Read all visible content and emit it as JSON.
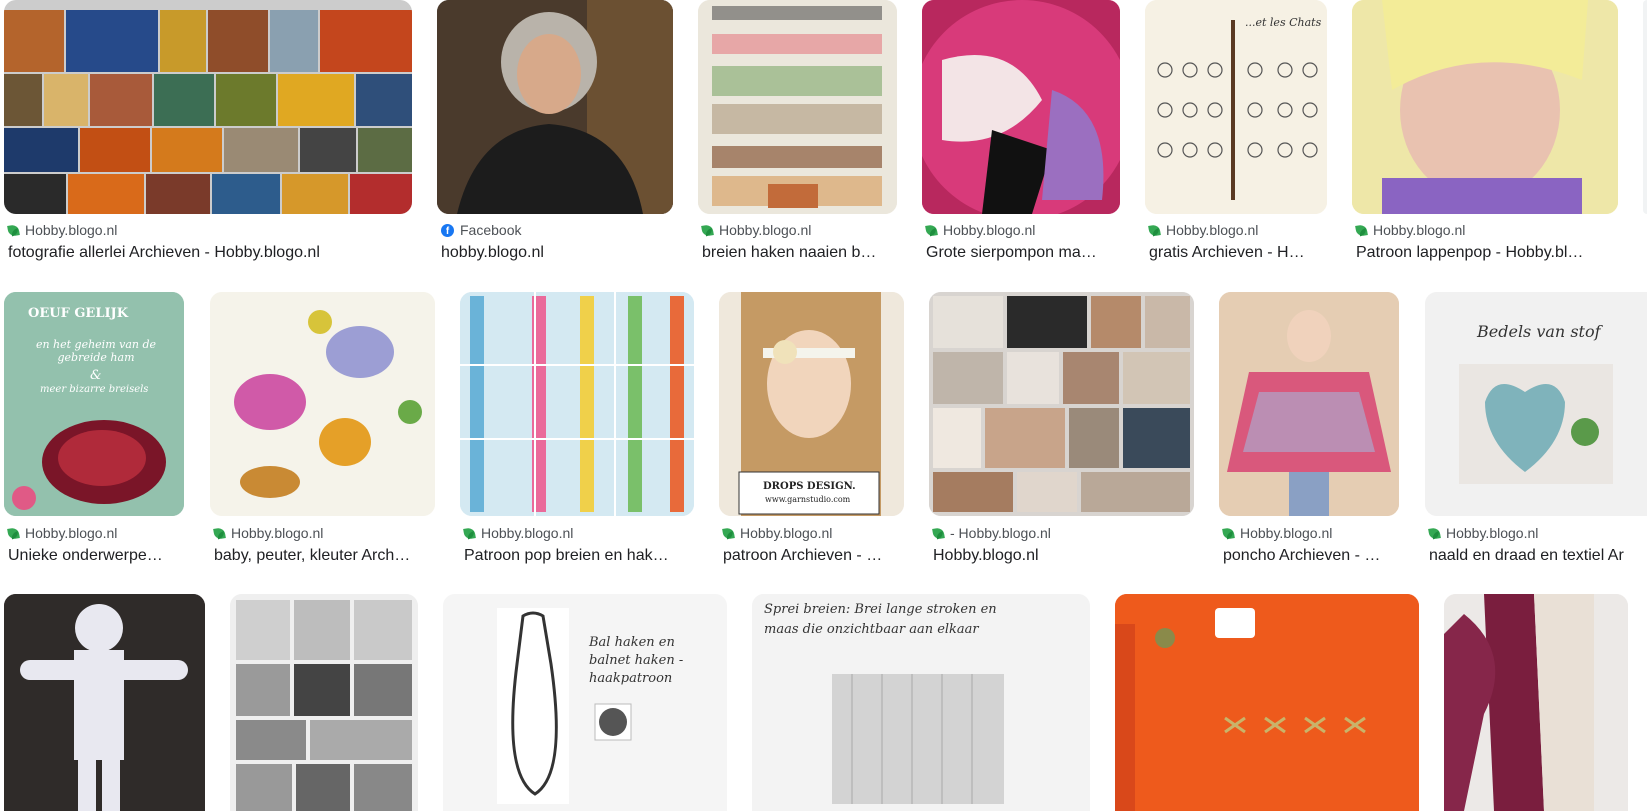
{
  "results": [
    {
      "source": "Hobby.blogo.nl",
      "title": "fotografie allerlei Archieven - Hobby.blogo.nl",
      "icon": "leaf-favicon-icon"
    },
    {
      "source": "Facebook",
      "title": "hobby.blogo.nl",
      "icon": "facebook-icon"
    },
    {
      "source": "Hobby.blogo.nl",
      "title": "breien haken naaien b…",
      "icon": "leaf-favicon-icon"
    },
    {
      "source": "Hobby.blogo.nl",
      "title": "Grote sierpompon ma…",
      "icon": "leaf-favicon-icon"
    },
    {
      "source": "Hobby.blogo.nl",
      "title": "gratis Archieven - H…",
      "icon": "leaf-favicon-icon"
    },
    {
      "source": "Hobby.blogo.nl",
      "title": "Patroon lappenpop - Hobby.bl…",
      "icon": "leaf-favicon-icon"
    },
    {
      "source": "Hobby.blogo.nl",
      "title": "Unieke onderwerpe…",
      "icon": "leaf-favicon-icon"
    },
    {
      "source": "Hobby.blogo.nl",
      "title": "baby, peuter, kleuter Arch…",
      "icon": "leaf-favicon-icon"
    },
    {
      "source": "Hobby.blogo.nl",
      "title": "Patroon pop breien en hak…",
      "icon": "leaf-favicon-icon"
    },
    {
      "source": "Hobby.blogo.nl",
      "title": "patroon Archieven - …",
      "icon": "leaf-favicon-icon"
    },
    {
      "source": "- Hobby.blogo.nl",
      "title": "Hobby.blogo.nl",
      "icon": "leaf-favicon-icon"
    },
    {
      "source": "Hobby.blogo.nl",
      "title": "poncho Archieven - …",
      "icon": "leaf-favicon-icon"
    },
    {
      "source": "Hobby.blogo.nl",
      "title": "naald en draad en textiel Ar",
      "icon": "leaf-favicon-icon"
    }
  ],
  "overlays": {
    "book_title": "OEUF GELIJK",
    "book_subtitle": "en het geheim van de gebreide ham",
    "book_amp": "&",
    "book_extra": "meer bizarre breisels",
    "drops": "DROPS DESIGN.",
    "drops_url": "www.garnstudio.com",
    "bedels": "Bedels van stof",
    "bal_haken": "Bal haken en balnet haken - haakpatroon",
    "sprei": "Sprei breien: Brei lange stroken en maas die onzichtbaar aan elkaar",
    "chats": "...et les Chats"
  },
  "colors": {
    "source_text": "#4d5156",
    "title_text": "#202124",
    "favicon_green": "#34a853",
    "facebook_blue": "#1877f2"
  }
}
